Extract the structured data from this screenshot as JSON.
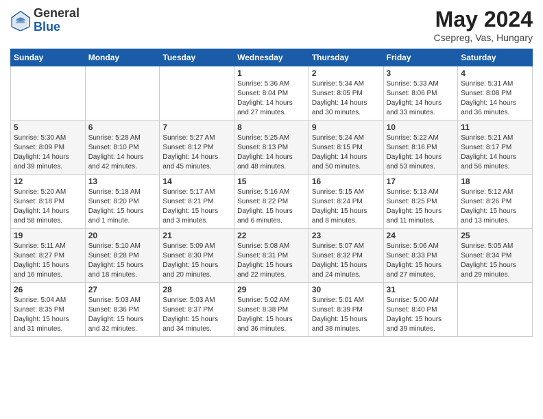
{
  "header": {
    "logo_general": "General",
    "logo_blue": "Blue",
    "month_year": "May 2024",
    "location": "Csepreg, Vas, Hungary"
  },
  "weekdays": [
    "Sunday",
    "Monday",
    "Tuesday",
    "Wednesday",
    "Thursday",
    "Friday",
    "Saturday"
  ],
  "weeks": [
    [
      {
        "day": "",
        "info": ""
      },
      {
        "day": "",
        "info": ""
      },
      {
        "day": "",
        "info": ""
      },
      {
        "day": "1",
        "info": "Sunrise: 5:36 AM\nSunset: 8:04 PM\nDaylight: 14 hours\nand 27 minutes."
      },
      {
        "day": "2",
        "info": "Sunrise: 5:34 AM\nSunset: 8:05 PM\nDaylight: 14 hours\nand 30 minutes."
      },
      {
        "day": "3",
        "info": "Sunrise: 5:33 AM\nSunset: 8:06 PM\nDaylight: 14 hours\nand 33 minutes."
      },
      {
        "day": "4",
        "info": "Sunrise: 5:31 AM\nSunset: 8:08 PM\nDaylight: 14 hours\nand 36 minutes."
      }
    ],
    [
      {
        "day": "5",
        "info": "Sunrise: 5:30 AM\nSunset: 8:09 PM\nDaylight: 14 hours\nand 39 minutes."
      },
      {
        "day": "6",
        "info": "Sunrise: 5:28 AM\nSunset: 8:10 PM\nDaylight: 14 hours\nand 42 minutes."
      },
      {
        "day": "7",
        "info": "Sunrise: 5:27 AM\nSunset: 8:12 PM\nDaylight: 14 hours\nand 45 minutes."
      },
      {
        "day": "8",
        "info": "Sunrise: 5:25 AM\nSunset: 8:13 PM\nDaylight: 14 hours\nand 48 minutes."
      },
      {
        "day": "9",
        "info": "Sunrise: 5:24 AM\nSunset: 8:15 PM\nDaylight: 14 hours\nand 50 minutes."
      },
      {
        "day": "10",
        "info": "Sunrise: 5:22 AM\nSunset: 8:16 PM\nDaylight: 14 hours\nand 53 minutes."
      },
      {
        "day": "11",
        "info": "Sunrise: 5:21 AM\nSunset: 8:17 PM\nDaylight: 14 hours\nand 56 minutes."
      }
    ],
    [
      {
        "day": "12",
        "info": "Sunrise: 5:20 AM\nSunset: 8:18 PM\nDaylight: 14 hours\nand 58 minutes."
      },
      {
        "day": "13",
        "info": "Sunrise: 5:18 AM\nSunset: 8:20 PM\nDaylight: 15 hours\nand 1 minute."
      },
      {
        "day": "14",
        "info": "Sunrise: 5:17 AM\nSunset: 8:21 PM\nDaylight: 15 hours\nand 3 minutes."
      },
      {
        "day": "15",
        "info": "Sunrise: 5:16 AM\nSunset: 8:22 PM\nDaylight: 15 hours\nand 6 minutes."
      },
      {
        "day": "16",
        "info": "Sunrise: 5:15 AM\nSunset: 8:24 PM\nDaylight: 15 hours\nand 8 minutes."
      },
      {
        "day": "17",
        "info": "Sunrise: 5:13 AM\nSunset: 8:25 PM\nDaylight: 15 hours\nand 11 minutes."
      },
      {
        "day": "18",
        "info": "Sunrise: 5:12 AM\nSunset: 8:26 PM\nDaylight: 15 hours\nand 13 minutes."
      }
    ],
    [
      {
        "day": "19",
        "info": "Sunrise: 5:11 AM\nSunset: 8:27 PM\nDaylight: 15 hours\nand 16 minutes."
      },
      {
        "day": "20",
        "info": "Sunrise: 5:10 AM\nSunset: 8:28 PM\nDaylight: 15 hours\nand 18 minutes."
      },
      {
        "day": "21",
        "info": "Sunrise: 5:09 AM\nSunset: 8:30 PM\nDaylight: 15 hours\nand 20 minutes."
      },
      {
        "day": "22",
        "info": "Sunrise: 5:08 AM\nSunset: 8:31 PM\nDaylight: 15 hours\nand 22 minutes."
      },
      {
        "day": "23",
        "info": "Sunrise: 5:07 AM\nSunset: 8:32 PM\nDaylight: 15 hours\nand 24 minutes."
      },
      {
        "day": "24",
        "info": "Sunrise: 5:06 AM\nSunset: 8:33 PM\nDaylight: 15 hours\nand 27 minutes."
      },
      {
        "day": "25",
        "info": "Sunrise: 5:05 AM\nSunset: 8:34 PM\nDaylight: 15 hours\nand 29 minutes."
      }
    ],
    [
      {
        "day": "26",
        "info": "Sunrise: 5:04 AM\nSunset: 8:35 PM\nDaylight: 15 hours\nand 31 minutes."
      },
      {
        "day": "27",
        "info": "Sunrise: 5:03 AM\nSunset: 8:36 PM\nDaylight: 15 hours\nand 32 minutes."
      },
      {
        "day": "28",
        "info": "Sunrise: 5:03 AM\nSunset: 8:37 PM\nDaylight: 15 hours\nand 34 minutes."
      },
      {
        "day": "29",
        "info": "Sunrise: 5:02 AM\nSunset: 8:38 PM\nDaylight: 15 hours\nand 36 minutes."
      },
      {
        "day": "30",
        "info": "Sunrise: 5:01 AM\nSunset: 8:39 PM\nDaylight: 15 hours\nand 38 minutes."
      },
      {
        "day": "31",
        "info": "Sunrise: 5:00 AM\nSunset: 8:40 PM\nDaylight: 15 hours\nand 39 minutes."
      },
      {
        "day": "",
        "info": ""
      }
    ]
  ]
}
